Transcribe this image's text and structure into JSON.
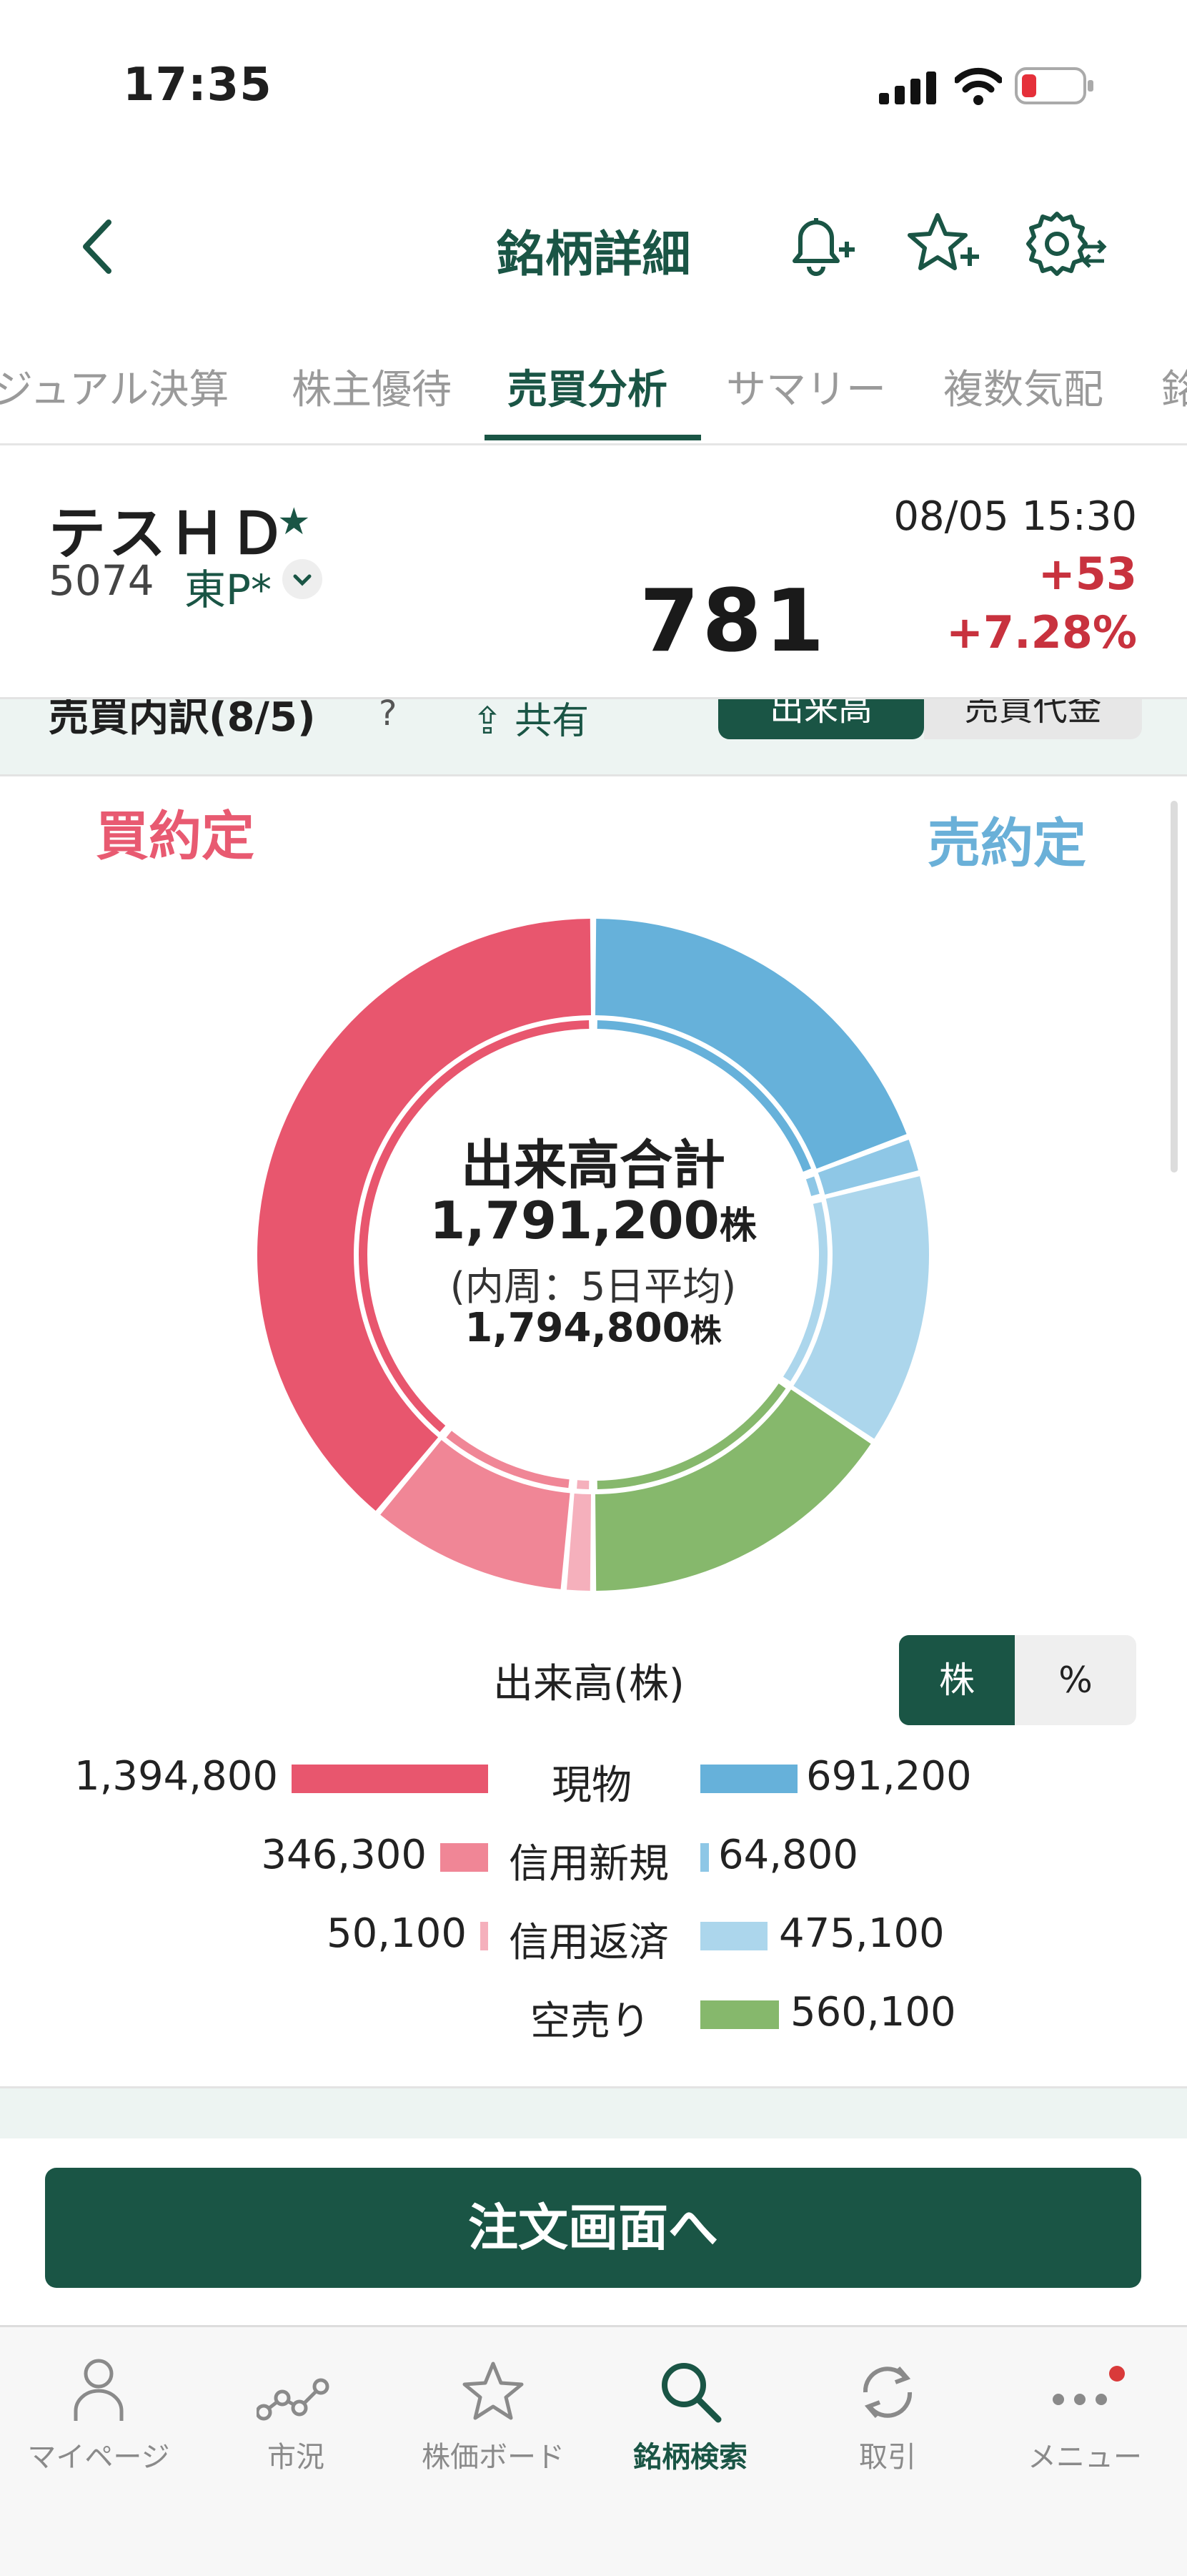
{
  "status_bar": {
    "time": "17:35"
  },
  "header": {
    "title": "銘柄詳細"
  },
  "tabs": [
    {
      "label": "ジュアル決算",
      "active": false
    },
    {
      "label": "株主優待",
      "active": false
    },
    {
      "label": "売買分析",
      "active": true
    },
    {
      "label": "サマリー",
      "active": false
    },
    {
      "label": "複数気配",
      "active": false
    },
    {
      "label": "銘",
      "active": false
    }
  ],
  "stock": {
    "name": "テスＨＤ",
    "code": "5074",
    "market": "東P*",
    "datetime": "08/05 15:30",
    "price": "781",
    "change": "+53",
    "change_pct": "+7.28%"
  },
  "section": {
    "title": "売買内訳(8/5)",
    "help": "?",
    "share_label": "共有",
    "toggle_volume": "出来高",
    "toggle_value": "売買代金"
  },
  "labels": {
    "buy": "買約定",
    "sell": "売約定"
  },
  "center": {
    "title": "出来高合計",
    "total": "1,791,200",
    "unit": "株",
    "subtitle": "(内周：5日平均)",
    "avg": "1,794,800"
  },
  "legend": {
    "title": "出来高(株)",
    "unit_shares": "株",
    "unit_percent": "%",
    "rows": [
      {
        "label": "現物",
        "buy": "1,394,800",
        "sell": "691,200"
      },
      {
        "label": "信用新規",
        "buy": "346,300",
        "sell": "64,800"
      },
      {
        "label": "信用返済",
        "buy": "50,100",
        "sell": "475,100"
      },
      {
        "label": "空売り",
        "buy": "",
        "sell": "560,100"
      }
    ]
  },
  "colors": {
    "buy_spot": "#e8566e",
    "buy_margin_new": "#f08696",
    "buy_margin_repay": "#f5b0bc",
    "sell_spot": "#66b1da",
    "sell_margin_new": "#8ec7e6",
    "sell_margin_repay": "#acd6ec",
    "short_sell": "#86b86c",
    "brand": "#1a5545",
    "up": "#c8323e"
  },
  "chart_data": {
    "type": "pie",
    "title": "出来高合計",
    "outer_series": [
      {
        "name": "買 現物",
        "value": 1394800
      },
      {
        "name": "買 信用新規",
        "value": 346300
      },
      {
        "name": "買 信用返済",
        "value": 50100
      },
      {
        "name": "売 現物",
        "value": 691200
      },
      {
        "name": "売 信用新規",
        "value": 64800
      },
      {
        "name": "売 信用返済",
        "value": 475100
      },
      {
        "name": "空売り",
        "value": 560100
      }
    ],
    "inner_total": 1794800
  },
  "order_button": "注文画面へ",
  "bottom_tabs": [
    {
      "label": "マイページ",
      "icon": "person-icon",
      "active": false
    },
    {
      "label": "市況",
      "icon": "market-chart-icon",
      "active": false
    },
    {
      "label": "株価ボード",
      "icon": "star-icon",
      "active": false
    },
    {
      "label": "銘柄検索",
      "icon": "search-icon",
      "active": true
    },
    {
      "label": "取引",
      "icon": "trade-refresh-icon",
      "active": false
    },
    {
      "label": "メニュー",
      "icon": "more-icon",
      "active": false
    }
  ]
}
